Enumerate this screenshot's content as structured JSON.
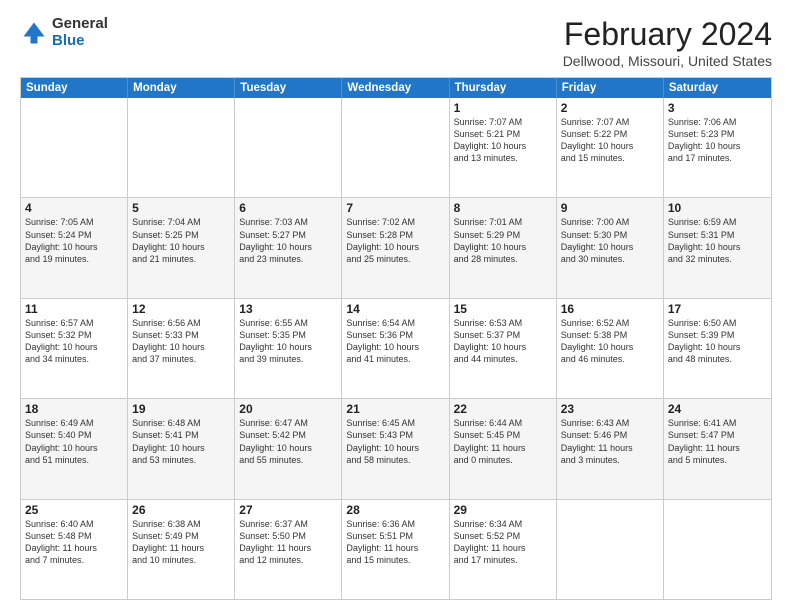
{
  "logo": {
    "general": "General",
    "blue": "Blue"
  },
  "title": {
    "month": "February 2024",
    "location": "Dellwood, Missouri, United States"
  },
  "header_days": [
    "Sunday",
    "Monday",
    "Tuesday",
    "Wednesday",
    "Thursday",
    "Friday",
    "Saturday"
  ],
  "rows": [
    {
      "shaded": false,
      "cells": [
        {
          "day": "",
          "info": ""
        },
        {
          "day": "",
          "info": ""
        },
        {
          "day": "",
          "info": ""
        },
        {
          "day": "",
          "info": ""
        },
        {
          "day": "1",
          "info": "Sunrise: 7:07 AM\nSunset: 5:21 PM\nDaylight: 10 hours\nand 13 minutes."
        },
        {
          "day": "2",
          "info": "Sunrise: 7:07 AM\nSunset: 5:22 PM\nDaylight: 10 hours\nand 15 minutes."
        },
        {
          "day": "3",
          "info": "Sunrise: 7:06 AM\nSunset: 5:23 PM\nDaylight: 10 hours\nand 17 minutes."
        }
      ]
    },
    {
      "shaded": true,
      "cells": [
        {
          "day": "4",
          "info": "Sunrise: 7:05 AM\nSunset: 5:24 PM\nDaylight: 10 hours\nand 19 minutes."
        },
        {
          "day": "5",
          "info": "Sunrise: 7:04 AM\nSunset: 5:25 PM\nDaylight: 10 hours\nand 21 minutes."
        },
        {
          "day": "6",
          "info": "Sunrise: 7:03 AM\nSunset: 5:27 PM\nDaylight: 10 hours\nand 23 minutes."
        },
        {
          "day": "7",
          "info": "Sunrise: 7:02 AM\nSunset: 5:28 PM\nDaylight: 10 hours\nand 25 minutes."
        },
        {
          "day": "8",
          "info": "Sunrise: 7:01 AM\nSunset: 5:29 PM\nDaylight: 10 hours\nand 28 minutes."
        },
        {
          "day": "9",
          "info": "Sunrise: 7:00 AM\nSunset: 5:30 PM\nDaylight: 10 hours\nand 30 minutes."
        },
        {
          "day": "10",
          "info": "Sunrise: 6:59 AM\nSunset: 5:31 PM\nDaylight: 10 hours\nand 32 minutes."
        }
      ]
    },
    {
      "shaded": false,
      "cells": [
        {
          "day": "11",
          "info": "Sunrise: 6:57 AM\nSunset: 5:32 PM\nDaylight: 10 hours\nand 34 minutes."
        },
        {
          "day": "12",
          "info": "Sunrise: 6:56 AM\nSunset: 5:33 PM\nDaylight: 10 hours\nand 37 minutes."
        },
        {
          "day": "13",
          "info": "Sunrise: 6:55 AM\nSunset: 5:35 PM\nDaylight: 10 hours\nand 39 minutes."
        },
        {
          "day": "14",
          "info": "Sunrise: 6:54 AM\nSunset: 5:36 PM\nDaylight: 10 hours\nand 41 minutes."
        },
        {
          "day": "15",
          "info": "Sunrise: 6:53 AM\nSunset: 5:37 PM\nDaylight: 10 hours\nand 44 minutes."
        },
        {
          "day": "16",
          "info": "Sunrise: 6:52 AM\nSunset: 5:38 PM\nDaylight: 10 hours\nand 46 minutes."
        },
        {
          "day": "17",
          "info": "Sunrise: 6:50 AM\nSunset: 5:39 PM\nDaylight: 10 hours\nand 48 minutes."
        }
      ]
    },
    {
      "shaded": true,
      "cells": [
        {
          "day": "18",
          "info": "Sunrise: 6:49 AM\nSunset: 5:40 PM\nDaylight: 10 hours\nand 51 minutes."
        },
        {
          "day": "19",
          "info": "Sunrise: 6:48 AM\nSunset: 5:41 PM\nDaylight: 10 hours\nand 53 minutes."
        },
        {
          "day": "20",
          "info": "Sunrise: 6:47 AM\nSunset: 5:42 PM\nDaylight: 10 hours\nand 55 minutes."
        },
        {
          "day": "21",
          "info": "Sunrise: 6:45 AM\nSunset: 5:43 PM\nDaylight: 10 hours\nand 58 minutes."
        },
        {
          "day": "22",
          "info": "Sunrise: 6:44 AM\nSunset: 5:45 PM\nDaylight: 11 hours\nand 0 minutes."
        },
        {
          "day": "23",
          "info": "Sunrise: 6:43 AM\nSunset: 5:46 PM\nDaylight: 11 hours\nand 3 minutes."
        },
        {
          "day": "24",
          "info": "Sunrise: 6:41 AM\nSunset: 5:47 PM\nDaylight: 11 hours\nand 5 minutes."
        }
      ]
    },
    {
      "shaded": false,
      "cells": [
        {
          "day": "25",
          "info": "Sunrise: 6:40 AM\nSunset: 5:48 PM\nDaylight: 11 hours\nand 7 minutes."
        },
        {
          "day": "26",
          "info": "Sunrise: 6:38 AM\nSunset: 5:49 PM\nDaylight: 11 hours\nand 10 minutes."
        },
        {
          "day": "27",
          "info": "Sunrise: 6:37 AM\nSunset: 5:50 PM\nDaylight: 11 hours\nand 12 minutes."
        },
        {
          "day": "28",
          "info": "Sunrise: 6:36 AM\nSunset: 5:51 PM\nDaylight: 11 hours\nand 15 minutes."
        },
        {
          "day": "29",
          "info": "Sunrise: 6:34 AM\nSunset: 5:52 PM\nDaylight: 11 hours\nand 17 minutes."
        },
        {
          "day": "",
          "info": ""
        },
        {
          "day": "",
          "info": ""
        }
      ]
    }
  ]
}
